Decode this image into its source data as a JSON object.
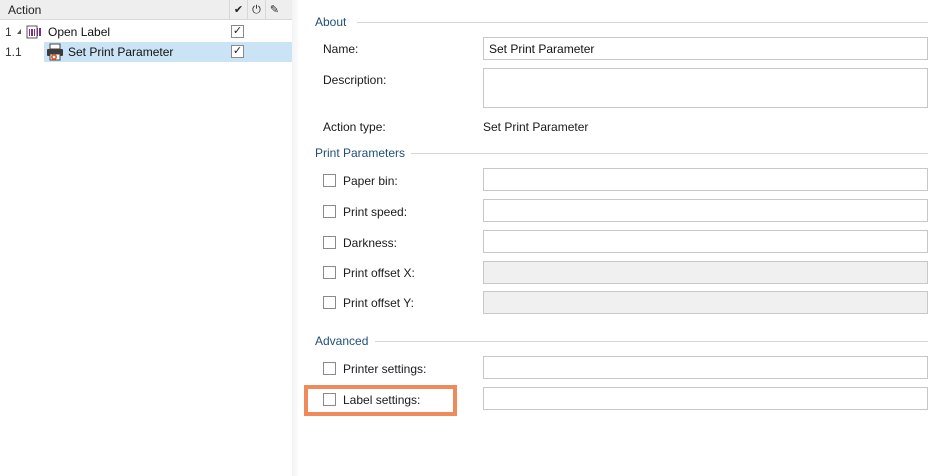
{
  "tree": {
    "header": {
      "action_label": "Action",
      "enabled_icon": "check-icon",
      "power_icon": "power-icon",
      "edit_icon": "pencil-icon"
    },
    "rows": [
      {
        "number": "1",
        "label": "Open Label",
        "icon": "label-icon",
        "checked": true,
        "expanded": true
      },
      {
        "number": "1.1",
        "label": "Set Print Parameter",
        "icon": "printer-icon",
        "checked": true,
        "selected": true
      }
    ]
  },
  "about": {
    "title": "About",
    "name_label": "Name:",
    "name_value": "Set Print Parameter",
    "description_label": "Description:",
    "description_value": "",
    "action_type_label": "Action type:",
    "action_type_value": "Set Print Parameter"
  },
  "print_parameters": {
    "title": "Print Parameters",
    "fields": [
      {
        "label": "Paper bin:",
        "value": "",
        "checked": false,
        "disabled": false
      },
      {
        "label": "Print speed:",
        "value": "",
        "checked": false,
        "disabled": false
      },
      {
        "label": "Darkness:",
        "value": "",
        "checked": false,
        "disabled": false
      },
      {
        "label": "Print offset X:",
        "value": "",
        "checked": false,
        "disabled": true
      },
      {
        "label": "Print offset Y:",
        "value": "",
        "checked": false,
        "disabled": true
      }
    ]
  },
  "advanced": {
    "title": "Advanced",
    "fields": [
      {
        "label": "Printer settings:",
        "value": "",
        "checked": false
      },
      {
        "label": "Label settings:",
        "value": "",
        "checked": false,
        "highlighted": true
      }
    ]
  },
  "colors": {
    "highlight": "#ef8a5a",
    "selection": "#cbe4f5",
    "group_title": "#1f4e79"
  }
}
